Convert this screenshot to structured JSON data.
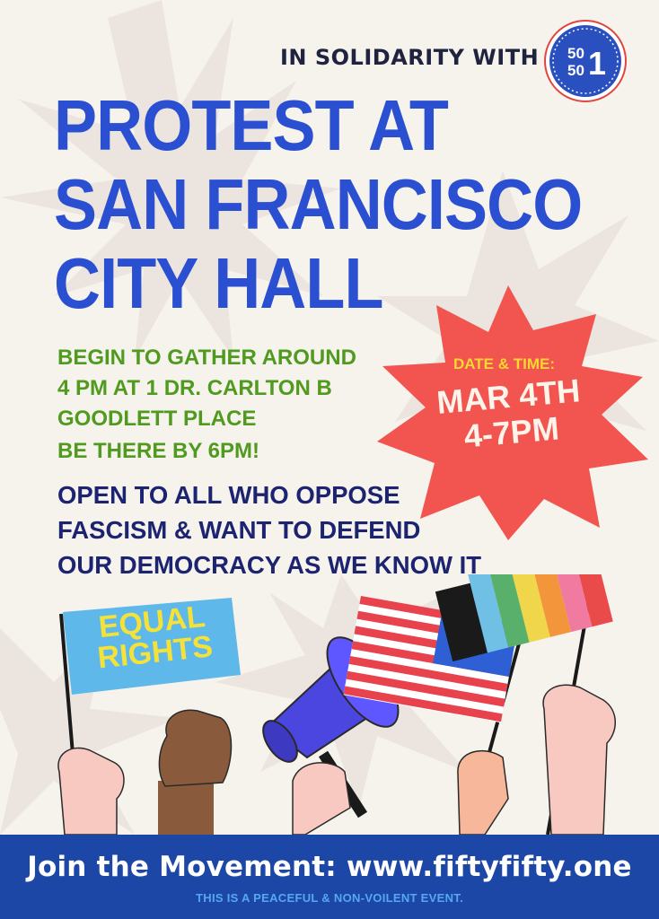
{
  "header": {
    "solidarity": "IN SOLIDARITY WITH",
    "logo_top": "50",
    "logo_bottom": "50",
    "logo_one": "1"
  },
  "title_lines": [
    "PROTEST AT",
    "SAN FRANCISCO",
    "CITY HALL"
  ],
  "gather": {
    "line1": "BEGIN TO GATHER AROUND",
    "line2": "4 PM AT 1 DR. CARLTON B",
    "line3": "GOODLETT PLACE",
    "by": "BE THERE BY 6PM!"
  },
  "open_lines": [
    "OPEN TO ALL WHO OPPOSE",
    "FASCISM & WANT TO DEFEND",
    "OUR DEMOCRACY AS WE KNOW IT"
  ],
  "datetime": {
    "label": "DATE & TIME:",
    "date": "MAR 4TH",
    "time": "4-7PM"
  },
  "sign": [
    "EQUAL",
    "RIGHTS"
  ],
  "footer": {
    "join": "Join the Movement: www.fiftyfifty.one",
    "note": "THIS IS A PEACEFUL & NON-VOILENT EVENT."
  },
  "colors": {
    "title_blue": "#2b4fd1",
    "gather_green": "#4f9a1f",
    "navy": "#1c2370",
    "star_red": "#f2544f",
    "footer_blue": "#1d47a6"
  },
  "icons": [
    "fiftyfifty-logo",
    "megaphone-icon",
    "american-flag",
    "rainbow-flag",
    "equal-rights-flag",
    "raised-fist-icon"
  ]
}
